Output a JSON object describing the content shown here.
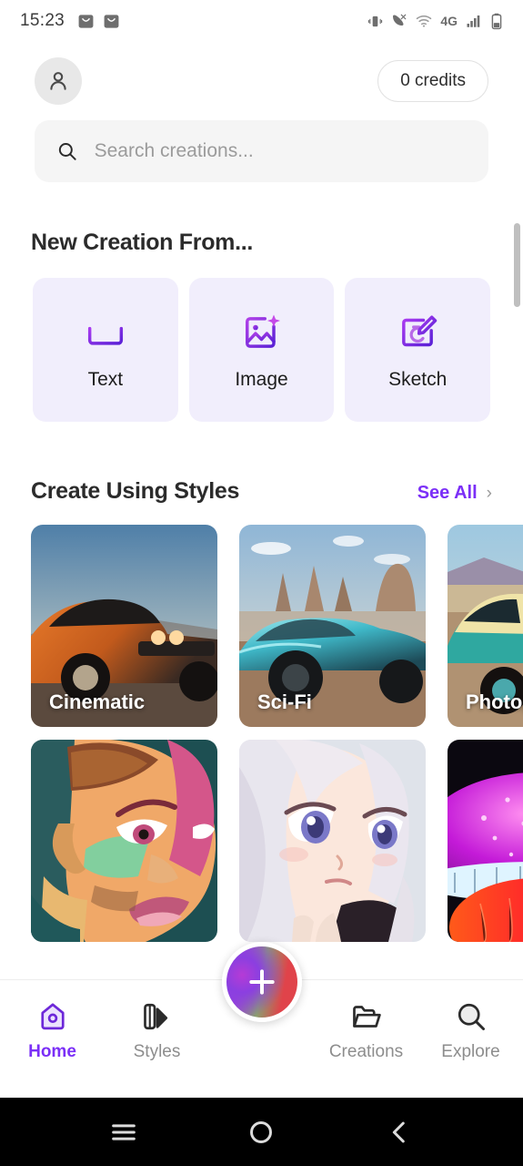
{
  "status_bar": {
    "time": "15:23",
    "left_icons": [
      "message-icon",
      "message-icon"
    ],
    "right_icons": [
      "vibrate-icon",
      "missed-call-icon",
      "wifi-icon",
      "signal-bars-icon",
      "battery-icon"
    ],
    "network": "4G"
  },
  "header": {
    "avatar_icon": "person-icon",
    "credits_label": "0 credits"
  },
  "search": {
    "placeholder": "Search creations...",
    "value": "",
    "icon": "search-icon"
  },
  "new_creation": {
    "title": "New Creation From...",
    "cards": [
      {
        "label": "Text",
        "icon": "text-box-icon"
      },
      {
        "label": "Image",
        "icon": "image-sparkle-icon"
      },
      {
        "label": "Sketch",
        "icon": "sketch-pencil-icon"
      }
    ]
  },
  "styles_section": {
    "title": "Create Using Styles",
    "see_all_label": "See All",
    "chevron_icon": "chevron-right-icon",
    "row1": [
      {
        "label": "Cinematic",
        "subject": "orange-muscle-car-dusk"
      },
      {
        "label": "Sci-Fi",
        "subject": "teal-futuristic-car-desert"
      },
      {
        "label": "Photography",
        "subject": "teal-cream-classic-car-desert"
      }
    ],
    "row2": [
      {
        "label": "",
        "subject": "colorful-comic-portrait"
      },
      {
        "label": "",
        "subject": "anime-white-hair-girl"
      },
      {
        "label": "",
        "subject": "glowing-magenta-mushroom"
      }
    ]
  },
  "bottom_nav": {
    "items": [
      {
        "label": "Home",
        "icon": "home-icon",
        "active": true
      },
      {
        "label": "Styles",
        "icon": "palette-icon",
        "active": false
      },
      {
        "label": "Creations",
        "icon": "folder-icon",
        "active": false
      },
      {
        "label": "Explore",
        "icon": "search-icon",
        "active": false
      }
    ],
    "fab": {
      "icon": "plus-icon",
      "label": ""
    }
  },
  "android_nav": {
    "recents_icon": "menu-icon",
    "home_icon": "circle-icon",
    "back_icon": "back-chevron-icon"
  },
  "colors": {
    "accent": "#7b2ff7",
    "card_bg": "#f1eefc",
    "search_bg": "#f5f5f5"
  }
}
